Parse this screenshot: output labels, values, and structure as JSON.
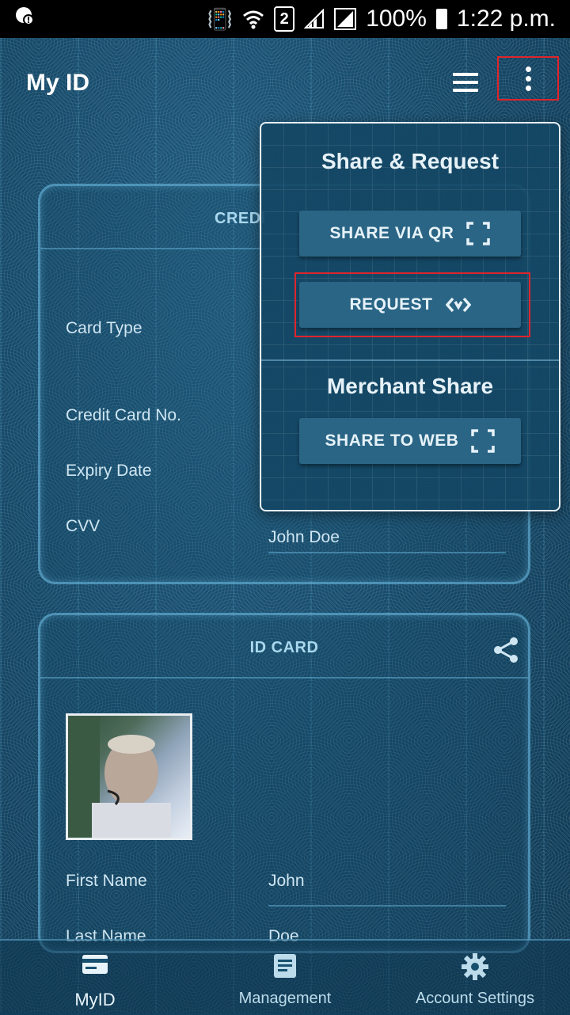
{
  "status_bar": {
    "battery_percent": "100%",
    "time": "1:22 p.m.",
    "sim_slot": "2"
  },
  "app_bar": {
    "title": "My ID"
  },
  "credit_card": {
    "title": "CREDI",
    "fields": [
      {
        "label": "Card Type",
        "value": ""
      },
      {
        "label": "Credit Card No.",
        "value": ""
      },
      {
        "label": "Expiry Date",
        "value": ""
      },
      {
        "label": "CVV",
        "value": "John Doe"
      }
    ]
  },
  "id_card": {
    "title": "ID CARD",
    "fields": [
      {
        "label": "First Name",
        "value": "John"
      },
      {
        "label": "Last Name",
        "value": "Doe"
      }
    ]
  },
  "popup": {
    "share_heading": "Share & Request",
    "share_qr_label": "SHARE VIA QR",
    "request_label": "REQUEST",
    "merchant_heading": "Merchant Share",
    "share_web_label": "SHARE TO WEB"
  },
  "bottom_nav": {
    "items": [
      {
        "label": "MyID",
        "icon": "card-icon",
        "active": true
      },
      {
        "label": "Management",
        "icon": "document-icon",
        "active": false
      },
      {
        "label": "Account Settings",
        "icon": "gear-icon",
        "active": false
      }
    ]
  },
  "colors": {
    "background": "#154a6a",
    "accent_border": "#6ebee6",
    "highlight_red": "#e0242b",
    "button": "#2a6585"
  }
}
